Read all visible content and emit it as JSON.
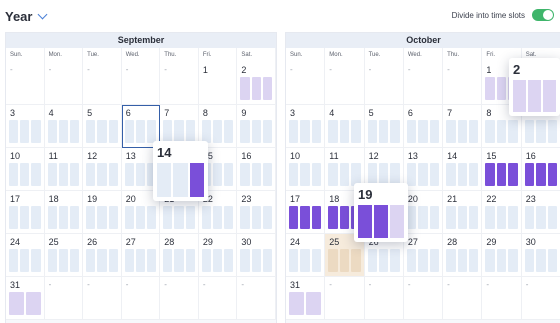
{
  "header": {
    "view_label": "Year",
    "slot_toggle_label": "Divide into time slots",
    "slot_toggle_on": true
  },
  "colors": {
    "accent": "#4a7fd6",
    "toggle_on": "#3fb56b",
    "slot_booked": "#7a4fd9",
    "slot_partial": "#b2a0e6",
    "slot_light": "#dcd4f2",
    "slot_empty": "#e4ecf6",
    "today_outline": "#355fa8"
  },
  "weekdays": [
    "Sun.",
    "Mon.",
    "Tue.",
    "Wed.",
    "Thu.",
    "Fri.",
    "Sat."
  ],
  "months": [
    {
      "name": "September",
      "cells": [
        {
          "label": "-"
        },
        {
          "label": "-"
        },
        {
          "label": "-"
        },
        {
          "label": "-"
        },
        {
          "label": "-"
        },
        {
          "label": "1"
        },
        {
          "label": "2",
          "slots": "lll"
        },
        {
          "label": "3",
          "slots": "eee"
        },
        {
          "label": "4",
          "slots": "eee"
        },
        {
          "label": "5",
          "slots": "eee"
        },
        {
          "label": "6",
          "slots": "eee",
          "today": true
        },
        {
          "label": "7",
          "slots": "eee"
        },
        {
          "label": "8",
          "slots": "eee"
        },
        {
          "label": "9",
          "slots": "eee"
        },
        {
          "label": "10",
          "slots": "eee"
        },
        {
          "label": "11",
          "slots": "eee"
        },
        {
          "label": "12",
          "slots": "eee"
        },
        {
          "label": "13",
          "slots": "eee"
        },
        {
          "label": "14",
          "slots": "eed"
        },
        {
          "label": "15",
          "slots": "eee"
        },
        {
          "label": "16",
          "slots": "eee"
        },
        {
          "label": "17",
          "slots": "eee"
        },
        {
          "label": "18",
          "slots": "eee"
        },
        {
          "label": "19",
          "slots": "eee"
        },
        {
          "label": "20",
          "slots": "eee"
        },
        {
          "label": "21",
          "slots": "eee"
        },
        {
          "label": "22",
          "slots": "eee"
        },
        {
          "label": "23",
          "slots": "eee"
        },
        {
          "label": "24",
          "slots": "eee"
        },
        {
          "label": "25",
          "slots": "eee"
        },
        {
          "label": "26",
          "slots": "eee"
        },
        {
          "label": "27",
          "slots": "eee"
        },
        {
          "label": "28",
          "slots": "eee"
        },
        {
          "label": "29",
          "slots": "eee"
        },
        {
          "label": "30",
          "slots": "eee"
        },
        {
          "label": "31",
          "slots": "ll"
        },
        {
          "label": "-"
        },
        {
          "label": "-"
        },
        {
          "label": "-"
        },
        {
          "label": "-"
        },
        {
          "label": "-"
        },
        {
          "label": "-"
        }
      ]
    },
    {
      "name": "October",
      "cells": [
        {
          "label": "-"
        },
        {
          "label": "-"
        },
        {
          "label": "-"
        },
        {
          "label": "-"
        },
        {
          "label": "-"
        },
        {
          "label": "1",
          "slots": "lll"
        },
        {
          "label": "2",
          "slots": "lll"
        },
        {
          "label": "3",
          "slots": "eee"
        },
        {
          "label": "4",
          "slots": "eee"
        },
        {
          "label": "5",
          "slots": "eee"
        },
        {
          "label": "6",
          "slots": "eee"
        },
        {
          "label": "7",
          "slots": "eee"
        },
        {
          "label": "8",
          "slots": "eee"
        },
        {
          "label": "9",
          "slots": "eee"
        },
        {
          "label": "10",
          "slots": "eee"
        },
        {
          "label": "11",
          "slots": "eee"
        },
        {
          "label": "12",
          "slots": "eee"
        },
        {
          "label": "13",
          "slots": "eee"
        },
        {
          "label": "14",
          "slots": "eee"
        },
        {
          "label": "15",
          "slots": "ddd"
        },
        {
          "label": "16",
          "slots": "ddd"
        },
        {
          "label": "17",
          "slots": "ddd"
        },
        {
          "label": "18",
          "slots": "ddd"
        },
        {
          "label": "19",
          "slots": "ddd"
        },
        {
          "label": "20",
          "slots": "eee"
        },
        {
          "label": "21",
          "slots": "eee"
        },
        {
          "label": "22",
          "slots": "eee"
        },
        {
          "label": "23",
          "slots": "eee"
        },
        {
          "label": "24",
          "slots": "eee"
        },
        {
          "label": "25",
          "slots": "eee",
          "highlight": true
        },
        {
          "label": "26",
          "slots": "eee"
        },
        {
          "label": "27",
          "slots": "eee"
        },
        {
          "label": "28",
          "slots": "eee"
        },
        {
          "label": "29",
          "slots": "eee"
        },
        {
          "label": "30",
          "slots": "eee"
        },
        {
          "label": "31",
          "slots": "ll"
        },
        {
          "label": "-"
        },
        {
          "label": "-"
        },
        {
          "label": "-"
        },
        {
          "label": "-"
        },
        {
          "label": "-"
        },
        {
          "label": "-"
        }
      ]
    }
  ],
  "popups": [
    {
      "day": "14",
      "slots": "eed"
    },
    {
      "day": "19",
      "slots": "ddl"
    },
    {
      "day": "2",
      "slots": "lll"
    }
  ]
}
